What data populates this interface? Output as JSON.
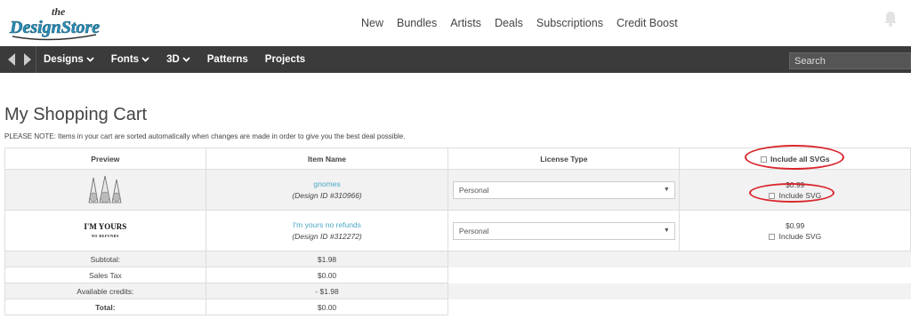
{
  "brand": {
    "name": "the Design Store",
    "line1": "the",
    "line2": "DesignStore"
  },
  "top_nav": [
    "New",
    "Bundles",
    "Artists",
    "Deals",
    "Subscriptions",
    "Credit Boost"
  ],
  "main_nav": [
    {
      "label": "Designs",
      "dropdown": true
    },
    {
      "label": "Fonts",
      "dropdown": true
    },
    {
      "label": "3D",
      "dropdown": true
    },
    {
      "label": "Patterns",
      "dropdown": false
    },
    {
      "label": "Projects",
      "dropdown": false
    }
  ],
  "search": {
    "placeholder": "Search"
  },
  "page": {
    "title": "My Shopping Cart",
    "note": "PLEASE NOTE: Items in your cart are sorted automatically when changes are made in order to give you the best deal possible."
  },
  "table": {
    "headers": {
      "preview": "Preview",
      "item": "Item Name",
      "license": "License Type",
      "include_all": "Include all SVGs"
    },
    "rows": [
      {
        "preview_text": "",
        "name": "gnomes",
        "design_id": "(Design ID #310966)",
        "license": "Personal",
        "price": "$0.99",
        "include_svg": "Include SVG"
      },
      {
        "preview_text": "I'M YOURS",
        "preview_sub": "NO REFUNDS",
        "name": "I'm yours no refunds",
        "design_id": "(Design ID #312272)",
        "license": "Personal",
        "price": "$0.99",
        "include_svg": "Include SVG"
      }
    ],
    "summary": [
      {
        "label": "Subtotal:",
        "value": "$1.98",
        "bold": false
      },
      {
        "label": "Sales Tax",
        "value": "$0.00",
        "bold": false
      },
      {
        "label": "Available credits:",
        "value": "- $1.98",
        "bold": false
      },
      {
        "label": "Total:",
        "value": "$0.00",
        "bold": true
      }
    ]
  },
  "colors": {
    "accent_link": "#4aa8c7",
    "nav_bg": "#3b3b3b",
    "annotation": "#d9262c",
    "logo_blue": "#2a8fb8"
  }
}
